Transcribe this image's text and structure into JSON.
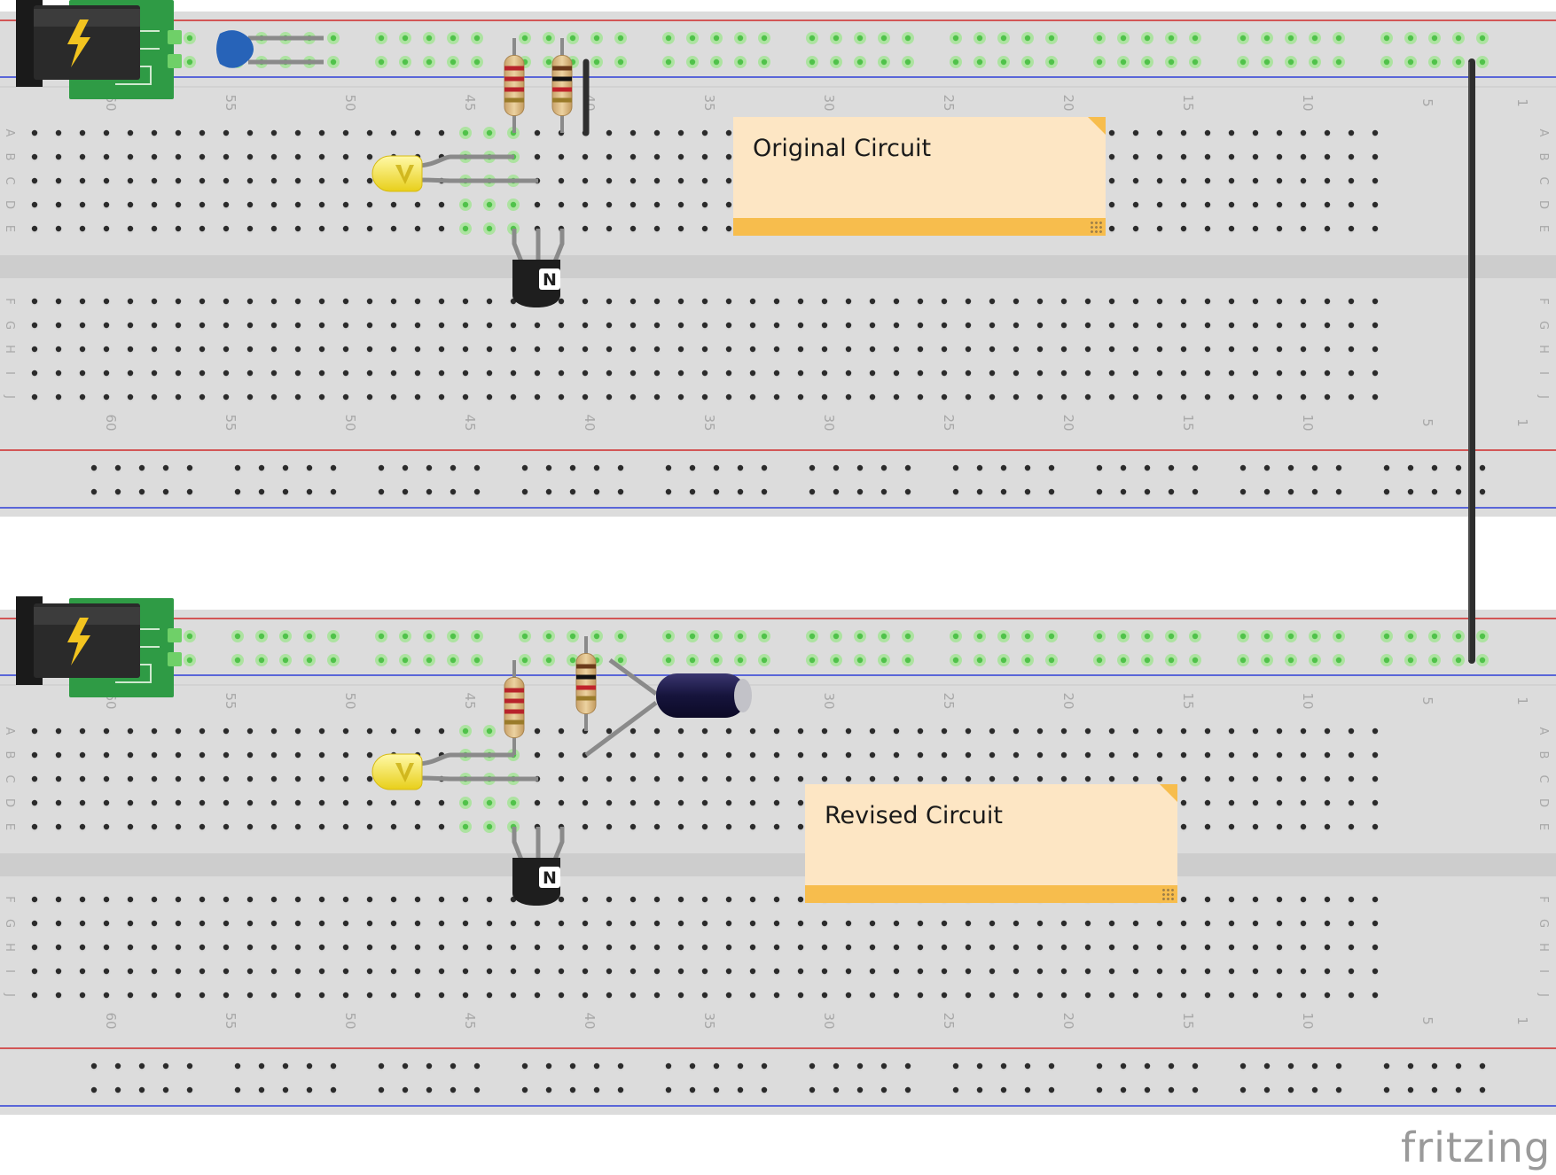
{
  "app": {
    "brand": "fritzing"
  },
  "colors": {
    "board": "#dcdcdc",
    "rail_red": "#cf2a2a",
    "rail_blue": "#2f3fd6",
    "hole": "#2b2b2b",
    "hole_connected": "#50c24a",
    "note_body": "#fde6c4",
    "note_bar": "#f7bd4d",
    "wire": "#2e2e2e",
    "lead": "#8a8a8a",
    "led": "#f6e53a",
    "pcb_green": "#2f9b45",
    "capacitor": "#1c1a4a"
  },
  "breadboard": {
    "column_numbers": [
      "60",
      "55",
      "50",
      "45",
      "40",
      "35",
      "30",
      "25",
      "20",
      "15",
      "10",
      "5",
      "1"
    ],
    "row_letters_top": [
      "A",
      "B",
      "C",
      "D",
      "E"
    ],
    "row_letters_bottom": [
      "F",
      "G",
      "H",
      "I",
      "J"
    ]
  },
  "circuits": [
    {
      "id": "original",
      "note_text": "Original Circuit",
      "components": [
        "power-jack",
        "ceramic-capacitor",
        "resistor",
        "resistor",
        "jumper-wire",
        "led",
        "npn-transistor"
      ]
    },
    {
      "id": "revised",
      "note_text": "Revised Circuit",
      "components": [
        "power-jack",
        "resistor",
        "resistor",
        "electrolytic-capacitor",
        "led",
        "npn-transistor"
      ]
    }
  ],
  "icons": {
    "power": "lightning-bolt-icon",
    "transistor": "npn-transistor-icon"
  }
}
